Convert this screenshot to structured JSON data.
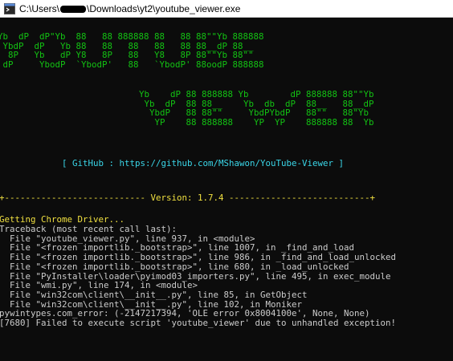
{
  "window": {
    "title_prefix": "C:\\Users\\",
    "title_suffix": "\\Downloads\\yt2\\youtube_viewer.exe",
    "icon": "console-icon"
  },
  "banner": {
    "art1": "Yb  dP  dP\"Yb  88   88 888888 88   88 88\"\"Yb 888888\n YbdP  dP   Yb 88   88   88   88   88 88__dP 88__\n  8P   Yb   dP Y8   8P   88   Y8   8P 88\"\"Yb 88\"\"\n dP     YbodP  `YbodP'   88   `YbodP' 88oodP 888888",
    "art2": "Yb    dP 88 888888 Yb        dP 888888 88\"\"Yb\n Yb  dP  88 88__    Yb  db  dP  88__   88__dP\n  YbdP   88 88\"\"     YbdPYbdP   88\"\"   88\"Yb\n   YP    88 888888    YP  YP    888888 88  Yb",
    "github": "[ GitHub : https://github.com/MShawon/YouTube-Viewer ]",
    "version": "+--------------------------- Version: 1.7.4 ---------------------------+"
  },
  "log": {
    "status": "Getting Chrome Driver...",
    "traceback": "Traceback (most recent call last):\n  File \"youtube_viewer.py\", line 937, in <module>\n  File \"<frozen importlib._bootstrap>\", line 1007, in _find_and_load\n  File \"<frozen importlib._bootstrap>\", line 986, in _find_and_load_unlocked\n  File \"<frozen importlib._bootstrap>\", line 680, in _load_unlocked\n  File \"PyInstaller\\loader\\pyimod03_importers.py\", line 495, in exec_module\n  File \"wmi.py\", line 174, in <module>\n  File \"win32com\\client\\__init__.py\", line 85, in GetObject\n  File \"win32com\\client\\__init__.py\", line 102, in Moniker\npywintypes.com_error: (-2147217394, 'OLE error 0x8004100e', None, None)\n[7680] Failed to execute script 'youtube_viewer' due to unhandled exception!"
  },
  "colors": {
    "green": "#13c313",
    "yellow": "#f0e040",
    "cyan": "#3ad6e8",
    "white": "#cccccc",
    "background": "#0c0c0c"
  }
}
